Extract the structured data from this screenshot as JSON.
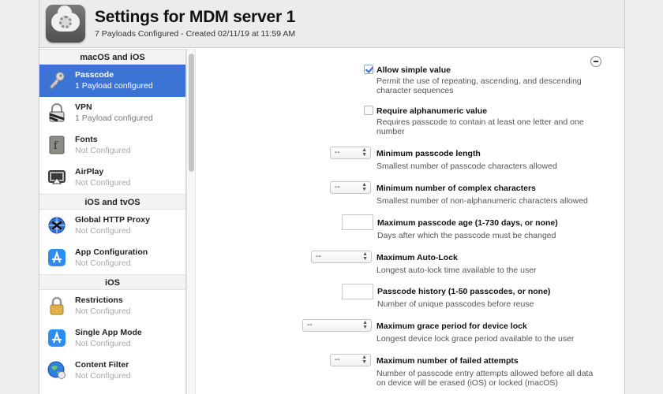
{
  "header": {
    "title": "Settings for MDM server 1",
    "subtitle": "7 Payloads Configured - Created 02/11/19 at 11:59 AM"
  },
  "sidebar": {
    "sections": [
      {
        "title": "macOS and iOS",
        "items": [
          {
            "label": "Passcode",
            "sub": "1 Payload configured",
            "icon": "key-icon"
          },
          {
            "label": "VPN",
            "sub": "1 Payload configured",
            "icon": "vpn-lock-icon"
          },
          {
            "label": "Fonts",
            "sub": "Not Configured",
            "icon": "font-icon"
          },
          {
            "label": "AirPlay",
            "sub": "Not Configured",
            "icon": "airplay-icon"
          }
        ]
      },
      {
        "title": "iOS and tvOS",
        "items": [
          {
            "label": "Global HTTP Proxy",
            "sub": "Not Configured",
            "icon": "globe-proxy-icon"
          },
          {
            "label": "App Configuration",
            "sub": "Not Configured",
            "icon": "app-store-icon"
          }
        ]
      },
      {
        "title": "iOS",
        "items": [
          {
            "label": "Restrictions",
            "sub": "Not Configured",
            "icon": "padlock-icon"
          },
          {
            "label": "Single App Mode",
            "sub": "Not Configured",
            "icon": "app-store-icon"
          },
          {
            "label": "Content Filter",
            "sub": "Not Configured",
            "icon": "globe-filter-icon"
          }
        ]
      }
    ]
  },
  "settings": {
    "allow_simple": {
      "label": "Allow simple value",
      "desc1": "Permit the use of repeating, ascending, and descending",
      "desc2": "character sequences",
      "checked": true
    },
    "require_alnum": {
      "label": "Require alphanumeric value",
      "desc1": "Requires passcode to contain at least one letter and one",
      "desc2": "number",
      "checked": false
    },
    "min_length": {
      "label": "Minimum passcode length",
      "desc": "Smallest number of passcode characters allowed",
      "value": "--"
    },
    "min_complex": {
      "label": "Minimum number of complex characters",
      "desc": "Smallest number of non-alphanumeric characters allowed",
      "value": "--"
    },
    "max_age": {
      "label": "Maximum passcode age (1-730 days, or none)",
      "desc": "Days after which the passcode must be changed"
    },
    "auto_lock": {
      "label": "Maximum Auto-Lock",
      "desc": "Longest auto-lock time available to the user",
      "value": "--"
    },
    "history": {
      "label": "Passcode history (1-50 passcodes, or none)",
      "desc": "Number of unique passcodes before reuse"
    },
    "grace": {
      "label": "Maximum grace period for device lock",
      "desc": "Longest device lock grace period available to the user",
      "value": "--"
    },
    "failed": {
      "label": "Maximum number of failed attempts",
      "desc1": "Number of passcode entry attempts allowed before all data",
      "desc2": "on device will be erased (iOS) or locked (macOS)",
      "value": "--"
    }
  },
  "colors": {
    "selection": "#3b74d4",
    "check": "#2f6bd1"
  }
}
